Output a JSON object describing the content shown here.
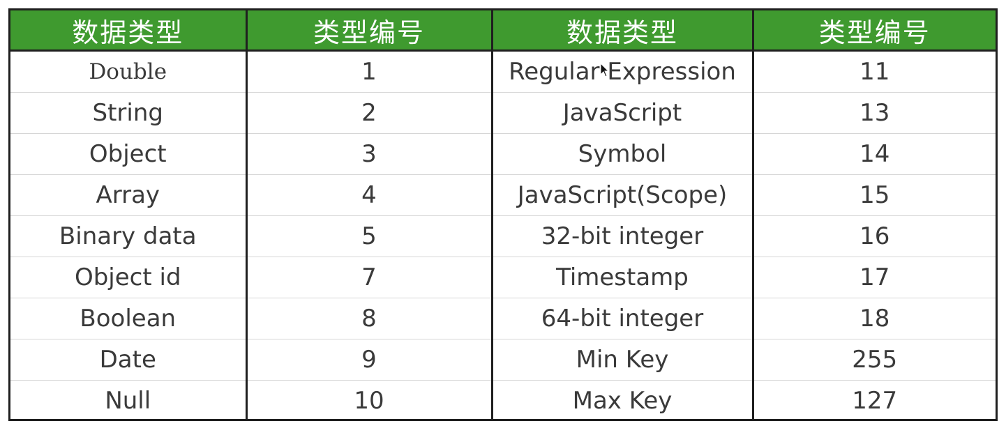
{
  "table": {
    "headers": [
      "数据类型",
      "类型编号",
      "数据类型",
      "类型编号"
    ],
    "rows": [
      {
        "type_a": "Double",
        "code_a": "1",
        "type_b": "Regular Expression",
        "code_b": "11"
      },
      {
        "type_a": "String",
        "code_a": "2",
        "type_b": "JavaScript",
        "code_b": "13"
      },
      {
        "type_a": "Object",
        "code_a": "3",
        "type_b": "Symbol",
        "code_b": "14"
      },
      {
        "type_a": "Array",
        "code_a": "4",
        "type_b": "JavaScript(Scope)",
        "code_b": "15"
      },
      {
        "type_a": "Binary data",
        "code_a": "5",
        "type_b": "32-bit integer",
        "code_b": "16"
      },
      {
        "type_a": "Object id",
        "code_a": "7",
        "type_b": "Timestamp",
        "code_b": "17"
      },
      {
        "type_a": "Boolean",
        "code_a": "8",
        "type_b": "64-bit integer",
        "code_b": "18"
      },
      {
        "type_a": "Date",
        "code_a": "9",
        "type_b": "Min Key",
        "code_b": "255"
      },
      {
        "type_a": "Null",
        "code_a": "10",
        "type_b": "Max Key",
        "code_b": "127"
      }
    ]
  },
  "colors": {
    "header_bg": "#3f9a2f",
    "header_text": "#ffffff",
    "border": "#1f1f1f",
    "cell_text": "#3a3a3a"
  },
  "icons": {
    "cursor": "mouse-pointer-icon"
  }
}
